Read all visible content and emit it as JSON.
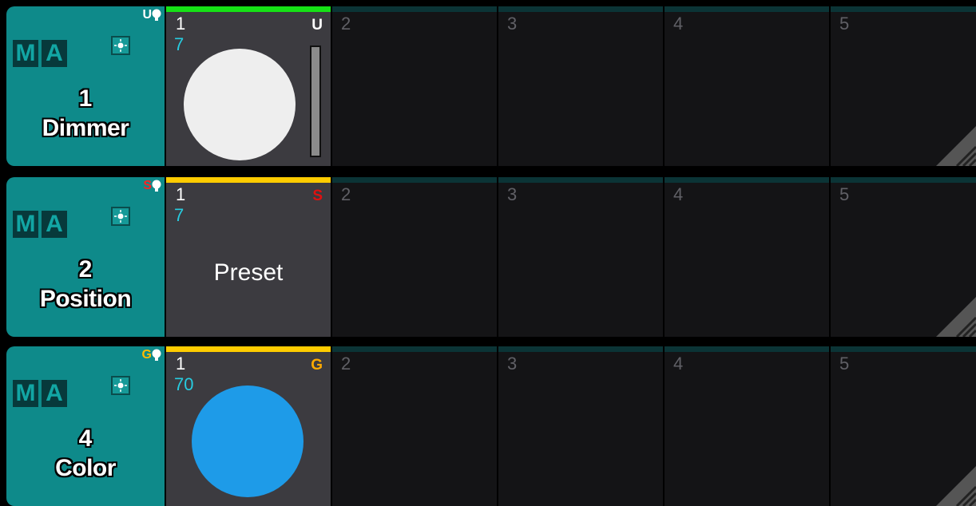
{
  "colors": {
    "header_bg": "#0e8a8a",
    "cell_bg": "#3c3b40",
    "empty_bg": "#141416",
    "dimmer_bar": "#16e216",
    "selected_bar": "#ffcc00",
    "value_text": "#27cce0"
  },
  "rows": [
    {
      "ma": [
        "M",
        "A"
      ],
      "flag": "U",
      "flag_color": "#ffffff",
      "number": "1",
      "name": "Dimmer",
      "cell": {
        "index": "1",
        "value": "7",
        "tag": "U",
        "tag_color": "#ffffff",
        "top_color": "#16e216",
        "visual": "white-circle",
        "fader_icon": "fader-bar"
      },
      "empty_cells": [
        "2",
        "3",
        "4",
        "5"
      ]
    },
    {
      "ma": [
        "M",
        "A"
      ],
      "flag": "S",
      "flag_color": "#ff2222",
      "number": "2",
      "name": "Position",
      "cell": {
        "index": "1",
        "value": "7",
        "tag": "S",
        "tag_color": "#e01010",
        "top_color": "#ffcc00",
        "preset_label": "Preset"
      },
      "empty_cells": [
        "2",
        "3",
        "4",
        "5"
      ]
    },
    {
      "ma": [
        "M",
        "A"
      ],
      "flag": "G",
      "flag_color": "#ffbb00",
      "number": "4",
      "name": "Color",
      "cell": {
        "index": "1",
        "value": "70",
        "tag": "G",
        "tag_color": "#ffaa00",
        "top_color": "#ffcc00",
        "visual": "blue-circle",
        "circle_color": "#1e9be8"
      },
      "empty_cells": [
        "2",
        "3",
        "4",
        "5"
      ]
    }
  ],
  "icons": [
    "gear-icon",
    "bulb-icon",
    "resize-grip-icon"
  ]
}
